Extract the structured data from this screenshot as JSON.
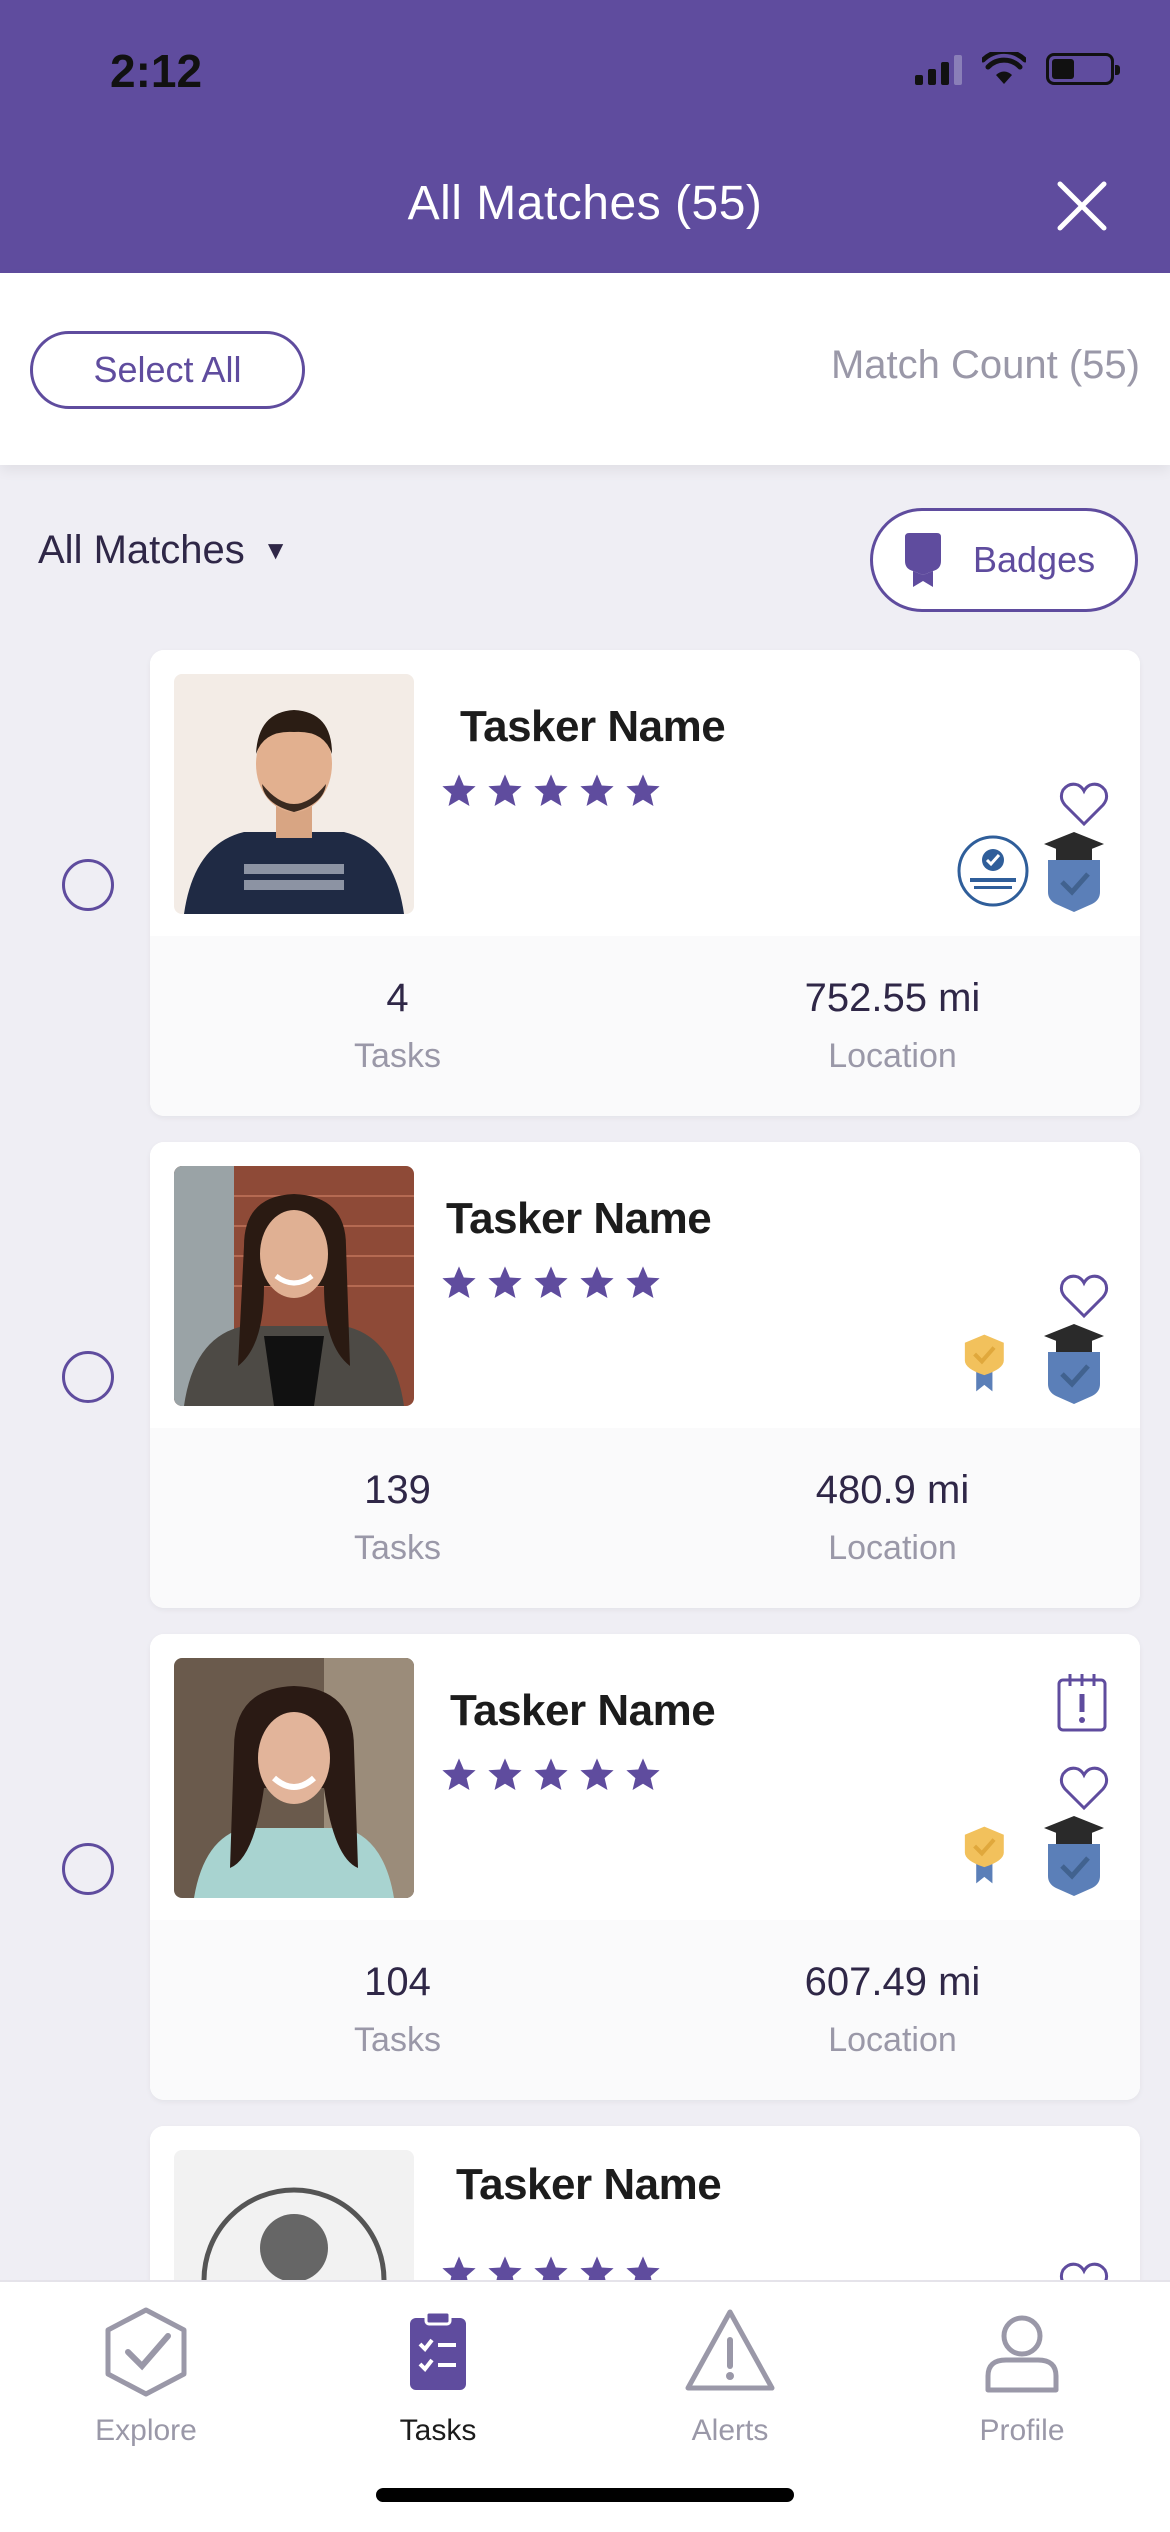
{
  "status_bar": {
    "time": "2:12"
  },
  "header": {
    "title": "All Matches (55)",
    "close_icon": "close-icon"
  },
  "toolbar": {
    "select_all_label": "Select All",
    "match_count": "Match Count (55)"
  },
  "filter": {
    "label": "All Matches",
    "badges_label": "Badges"
  },
  "cards": [
    {
      "name": "Tasker Name",
      "rating": 5,
      "tasks_value": "4",
      "tasks_label": "Tasks",
      "location_value": "752.55 mi",
      "location_label": "Location",
      "badges": [
        "unsupervised-task-specialist-badge",
        "graduate-badge"
      ],
      "has_alert": false
    },
    {
      "name": "Tasker Name",
      "rating": 5,
      "tasks_value": "139",
      "tasks_label": "Tasks",
      "location_value": "480.9 mi",
      "location_label": "Location",
      "badges": [
        "gold-ribbon-badge",
        "graduate-badge"
      ],
      "has_alert": false
    },
    {
      "name": "Tasker Name",
      "rating": 5,
      "tasks_value": "104",
      "tasks_label": "Tasks",
      "location_value": "607.49 mi",
      "location_label": "Location",
      "badges": [
        "gold-ribbon-badge",
        "graduate-badge"
      ],
      "has_alert": true
    },
    {
      "name": "Tasker Name",
      "rating": 5
    }
  ],
  "bottom_nav": [
    {
      "label": "Explore",
      "icon": "explore-icon",
      "active": false
    },
    {
      "label": "Tasks",
      "icon": "tasks-icon",
      "active": true
    },
    {
      "label": "Alerts",
      "icon": "alert-triangle-icon",
      "active": false
    },
    {
      "label": "Profile",
      "icon": "profile-icon",
      "active": false
    }
  ],
  "colors": {
    "brand": "#5f4c9e",
    "background": "#efeef4",
    "muted_text": "#9a98a8",
    "gold": "#f2c15c",
    "badge_blue": "#5b7fb8"
  }
}
